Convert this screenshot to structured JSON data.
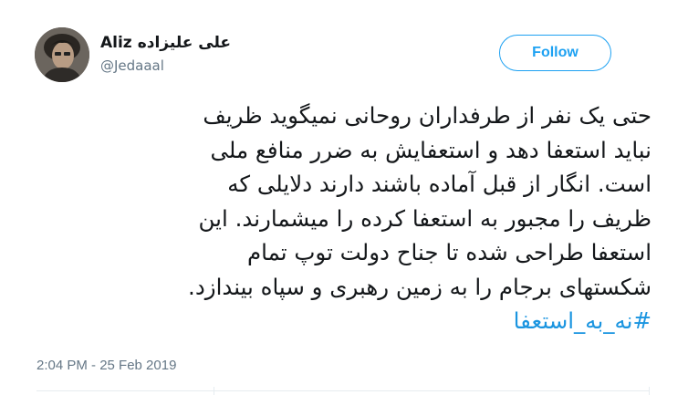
{
  "tweet": {
    "author": {
      "display_name_latin": "Aliz",
      "display_name_persian": "علی علیزاده",
      "handle": "@Jedaaal",
      "avatar_icon": "user-photo"
    },
    "follow_button_label": "Follow",
    "lines": [
      "حتی یک نفر از طرفداران روحانی نمیگوید ظریف",
      "نباید استعفا دهد و استعفایش به ضرر منافع ملی",
      "است. انگار از قبل آماده باشند دارند دلایلی که",
      "ظریف را مجبور به استعفا کرده را میشمارند. این",
      "استعفا طراحی شده تا جناح دولت توپ تمام",
      "شکستهای برجام را به زمین رهبری و سپاه بیندازد."
    ],
    "hashtag": "#نه_به_استعفا",
    "timestamp": "2:04 PM - 25 Feb 2019",
    "colors": {
      "accent": "#1da1f2",
      "hashtag": "#1b95e0",
      "text": "#14171a",
      "muted": "#657786"
    }
  }
}
